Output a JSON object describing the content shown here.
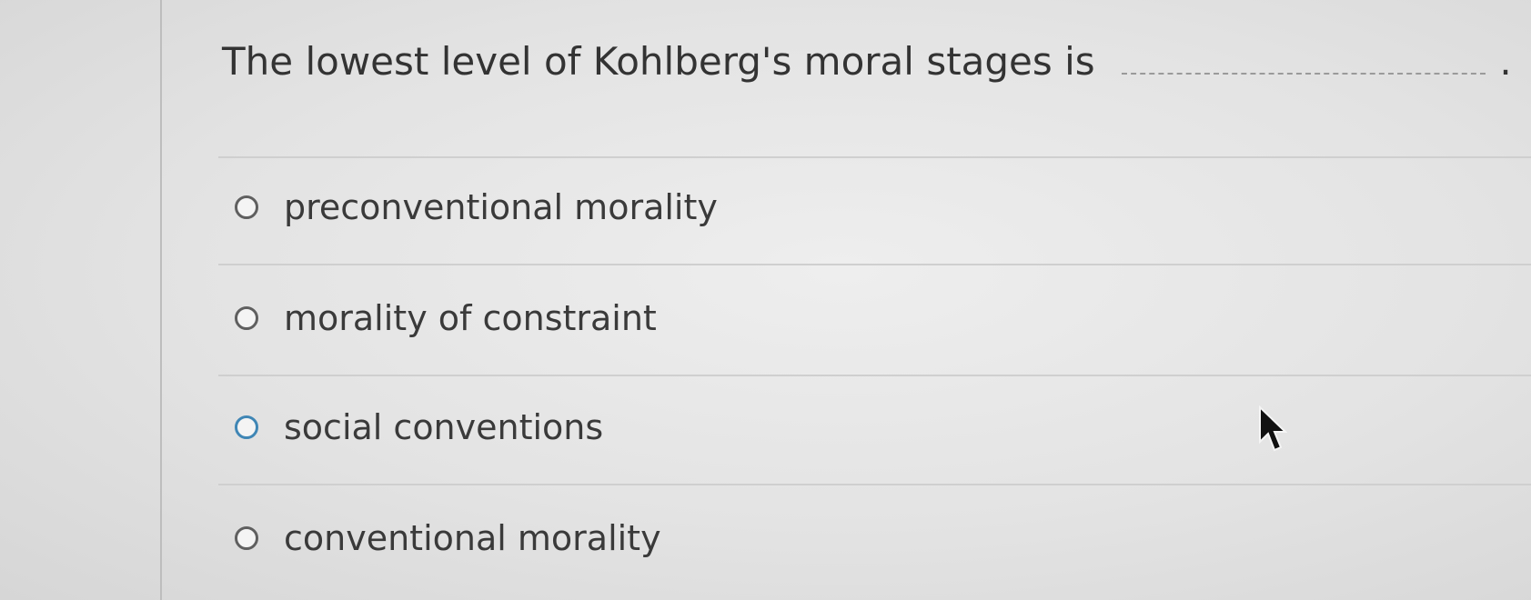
{
  "question": {
    "text": "The lowest level of Kohlberg's moral stages is",
    "period": "."
  },
  "options": [
    {
      "label": "preconventional morality",
      "selected": false
    },
    {
      "label": "morality of constraint",
      "selected": false
    },
    {
      "label": "social conventions",
      "selected": false,
      "focused": true
    },
    {
      "label": "conventional morality",
      "selected": false
    }
  ],
  "colors": {
    "radio_border": "#5f5f5f",
    "radio_focus": "#3f86b5",
    "text": "#3a3a3a"
  }
}
